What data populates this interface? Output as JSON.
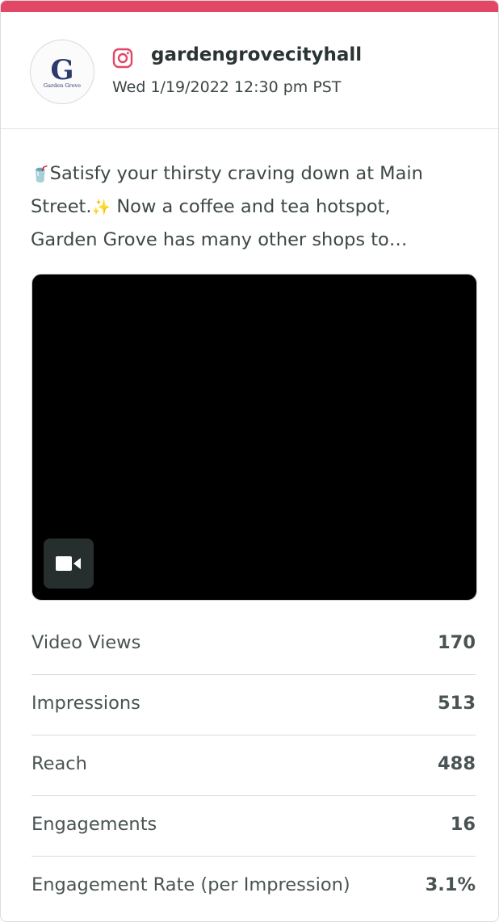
{
  "accent_color": "#e24766",
  "post": {
    "network_icon": "instagram-icon",
    "account_name": "gardengrovecityhall",
    "date": "Wed 1/19/2022 12:30 pm PST",
    "avatar": {
      "logo_letters": "G",
      "logo_text": "Garden Grove"
    },
    "caption": {
      "line1_emoji": "🥤",
      "line1_text": "Satisfy your thirsty craving down at Main",
      "line2_text_a": "Street.",
      "line2_emoji": "✨",
      "line2_text_b": " Now a coffee and tea hotspot,",
      "line3_text": "Garden Grove has many other shops to…"
    },
    "media": {
      "type": "video",
      "icon": "video-camera-icon"
    }
  },
  "metrics": [
    {
      "label": "Video Views",
      "value": "170"
    },
    {
      "label": "Impressions",
      "value": "513"
    },
    {
      "label": "Reach",
      "value": "488"
    },
    {
      "label": "Engagements",
      "value": "16"
    },
    {
      "label": "Engagement Rate (per Impression)",
      "value": "3.1%"
    }
  ]
}
